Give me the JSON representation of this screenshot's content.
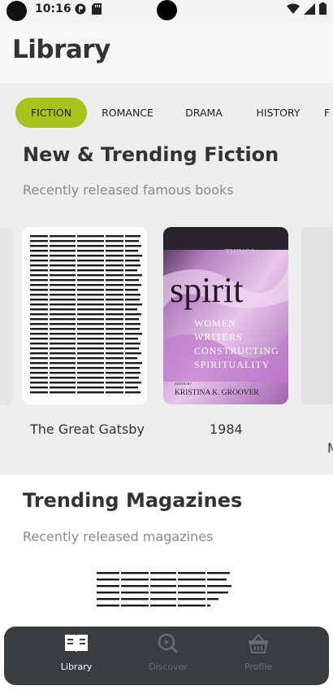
{
  "status_bar": {
    "time": "10:16"
  },
  "header": {
    "title": "Library"
  },
  "tabs": [
    {
      "label": "FICTION",
      "active": true
    },
    {
      "label": "ROMANCE",
      "active": false
    },
    {
      "label": "DRAMA",
      "active": false
    },
    {
      "label": "HISTORY",
      "active": false
    },
    {
      "label": "F",
      "active": false
    }
  ],
  "fiction_section": {
    "title": "New & Trending Fiction",
    "subtitle": "Recently released famous books",
    "books": [
      {
        "title": "The Great Gatsby"
      },
      {
        "title": "1984"
      },
      {
        "title": "M"
      }
    ],
    "spirit_cover": {
      "top_word": "THINGS",
      "big_word": "spirit",
      "lines": [
        "WOMEN",
        "WRITERS",
        "CONSTRUCTING",
        "SPIRITUALITY"
      ],
      "edited_by": "EDITED BY",
      "editor": "KRISTINA K. GROOVER"
    }
  },
  "magazines_section": {
    "title": "Trending Magazines",
    "subtitle": "Recently released magazines"
  },
  "bottom_nav": {
    "items": [
      {
        "label": "Library",
        "icon": "book-icon",
        "active": true
      },
      {
        "label": "Discover",
        "icon": "search-icon",
        "active": false
      },
      {
        "label": "Profile",
        "icon": "basket-icon",
        "active": false
      }
    ]
  },
  "colors": {
    "accent": "#a7c21a",
    "nav_bg": "#3a3d40",
    "spirit_purple": "#c89bd0"
  }
}
